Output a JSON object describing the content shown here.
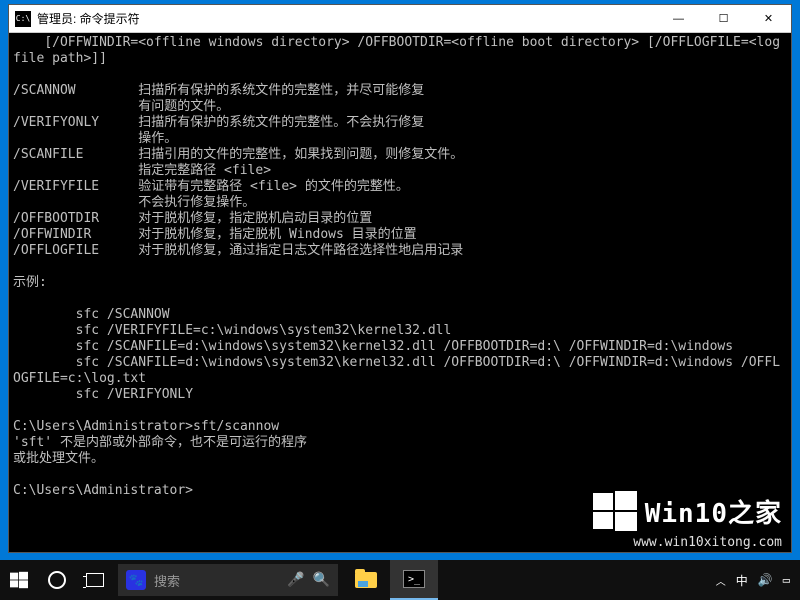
{
  "window": {
    "title": "管理员: 命令提示符",
    "icon_label": "C:\\"
  },
  "win_controls": {
    "min": "—",
    "max": "☐",
    "close": "✕"
  },
  "terminal": {
    "lines": [
      "    [/OFFWINDIR=<offline windows directory> /OFFBOOTDIR=<offline boot directory> [/OFFLOGFILE=<log file path>]]",
      "",
      "/SCANNOW        扫描所有保护的系统文件的完整性，并尽可能修复",
      "                有问题的文件。",
      "/VERIFYONLY     扫描所有保护的系统文件的完整性。不会执行修复",
      "                操作。",
      "/SCANFILE       扫描引用的文件的完整性，如果找到问题，则修复文件。",
      "                指定完整路径 <file>",
      "/VERIFYFILE     验证带有完整路径 <file> 的文件的完整性。",
      "                不会执行修复操作。",
      "/OFFBOOTDIR     对于脱机修复，指定脱机启动目录的位置",
      "/OFFWINDIR      对于脱机修复，指定脱机 Windows 目录的位置",
      "/OFFLOGFILE     对于脱机修复，通过指定日志文件路径选择性地启用记录",
      "",
      "示例:",
      "",
      "        sfc /SCANNOW",
      "        sfc /VERIFYFILE=c:\\windows\\system32\\kernel32.dll",
      "        sfc /SCANFILE=d:\\windows\\system32\\kernel32.dll /OFFBOOTDIR=d:\\ /OFFWINDIR=d:\\windows",
      "        sfc /SCANFILE=d:\\windows\\system32\\kernel32.dll /OFFBOOTDIR=d:\\ /OFFWINDIR=d:\\windows /OFFLOGFILE=c:\\log.txt",
      "        sfc /VERIFYONLY",
      "",
      "C:\\Users\\Administrator>sft/scannow",
      "'sft' 不是内部或外部命令，也不是可运行的程序",
      "或批处理文件。",
      "",
      "C:\\Users\\Administrator>"
    ]
  },
  "taskbar": {
    "search_placeholder": "搜索",
    "tray": {
      "chevron": "︿",
      "ime": "中",
      "volume": "🔊",
      "action": "▭"
    }
  },
  "watermark": {
    "brand_en": "Win10",
    "brand_zh": "之家",
    "url": "www.win10xitong.com"
  }
}
